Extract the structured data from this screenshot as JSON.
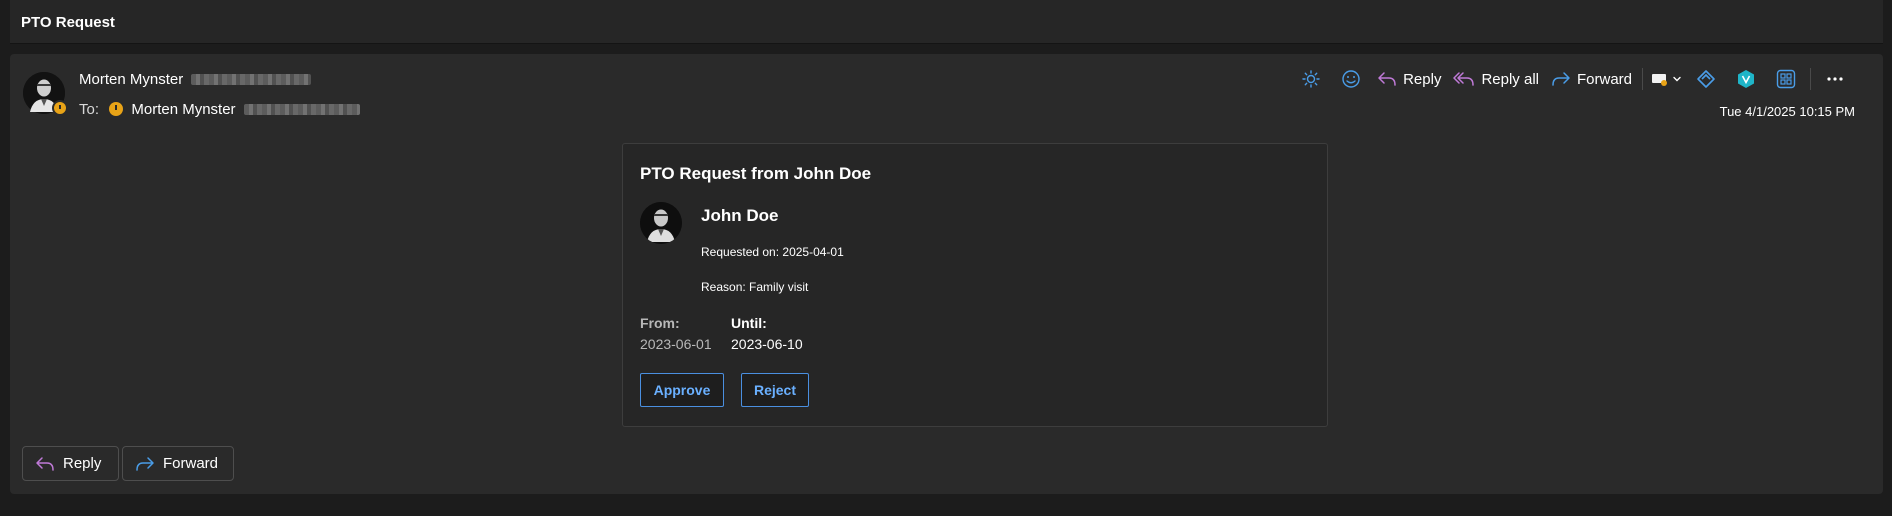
{
  "window": {
    "title": "PTO Request"
  },
  "header": {
    "sender_name": "Morten Mynster",
    "to_label": "To:",
    "recipient_name": "Morten Mynster",
    "timestamp": "Tue 4/1/2025 10:15 PM"
  },
  "toolbar": {
    "reply_label": "Reply",
    "reply_all_label": "Reply all",
    "forward_label": "Forward"
  },
  "card": {
    "title": "PTO Request from John Doe",
    "name": "John Doe",
    "requested_on": "Requested on: 2025-04-01",
    "reason": "Reason: Family visit",
    "from_label": "From:",
    "from_value": "2023-06-01",
    "until_label": "Until:",
    "until_value": "2023-06-10",
    "approve_label": "Approve",
    "reject_label": "Reject"
  },
  "footer": {
    "reply_label": "Reply",
    "forward_label": "Forward"
  },
  "colors": {
    "background": "#1c1c1c",
    "panel": "#2a2a2a",
    "accent_blue": "#4a8fe0",
    "reply_purple": "#c07ad8",
    "forward_blue": "#4a9de8",
    "presence_away": "#e8a317"
  }
}
